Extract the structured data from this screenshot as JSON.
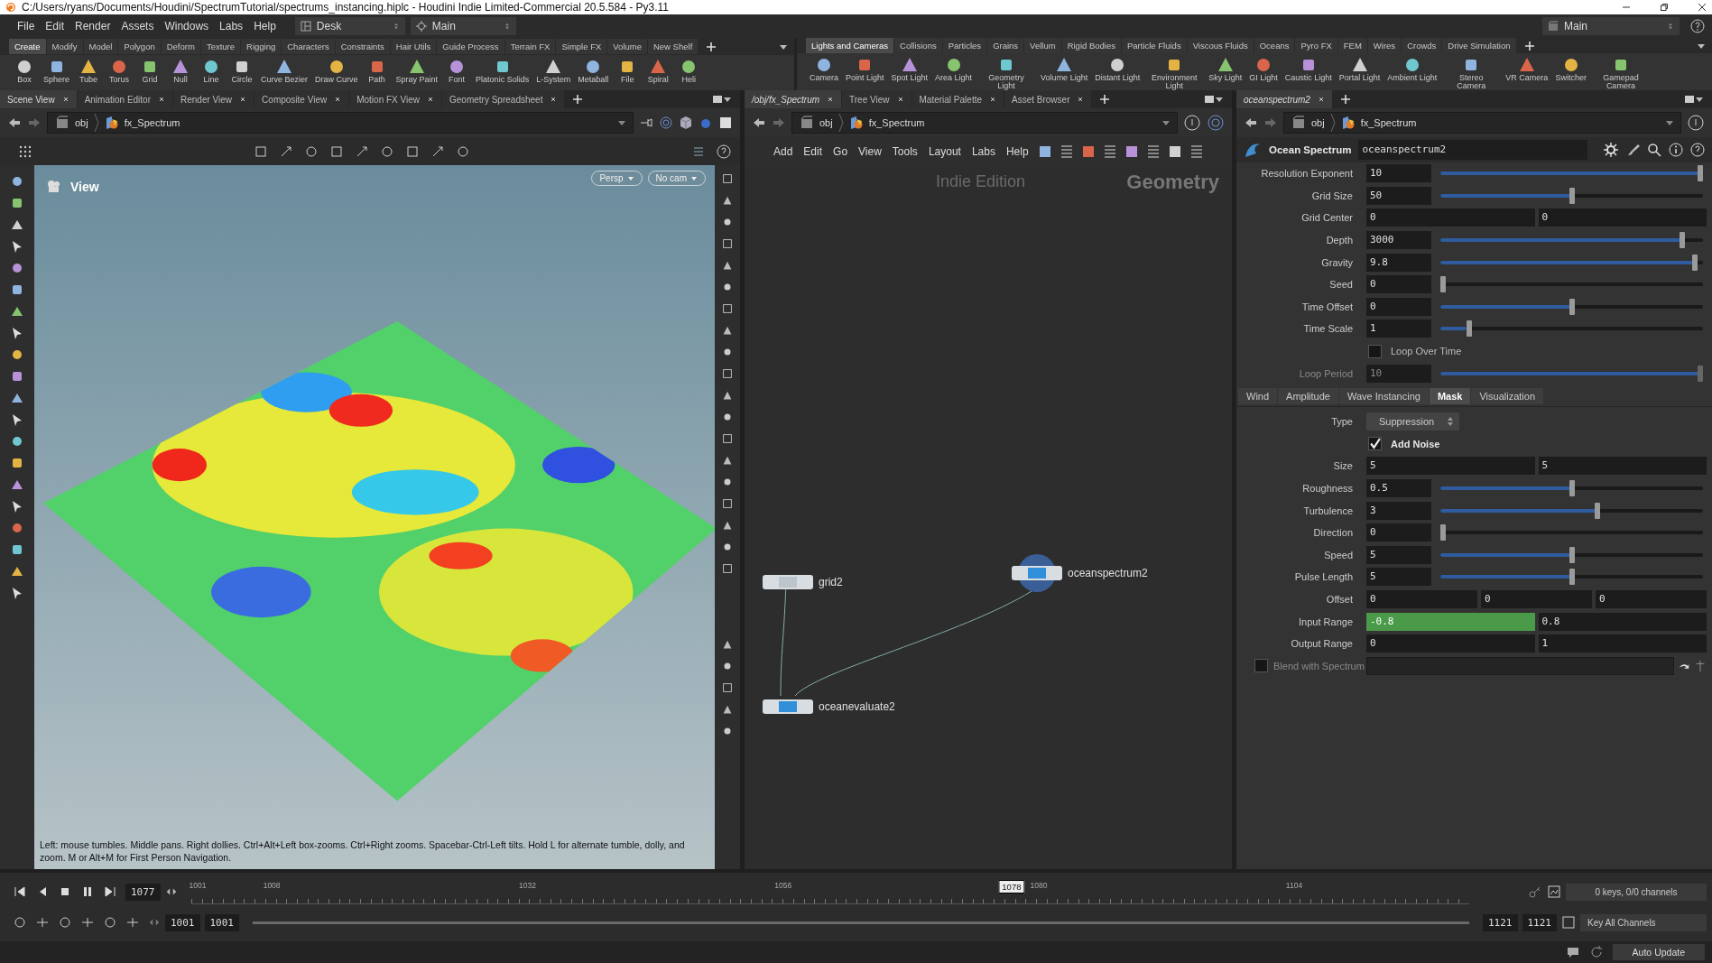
{
  "window": {
    "title": "C:/Users/ryans/Documents/Houdini/SpectrumTutorial/spectrums_instancing.hiplc - Houdini Indie Limited-Commercial 20.5.584 - Py3.11"
  },
  "menu": [
    "File",
    "Edit",
    "Render",
    "Assets",
    "Windows",
    "Labs",
    "Help"
  ],
  "desktop": {
    "label": "Desk"
  },
  "context": {
    "label": "Main"
  },
  "right_context": {
    "label": "Main"
  },
  "shelves": [
    {
      "tabs": [
        {
          "label": "Create",
          "selected": true
        },
        {
          "label": "Modify",
          "selected": false
        },
        {
          "label": "Model",
          "selected": false
        },
        {
          "label": "Polygon",
          "selected": false
        },
        {
          "label": "Deform",
          "selected": false
        },
        {
          "label": "Texture",
          "selected": false
        },
        {
          "label": "Rigging",
          "selected": false
        },
        {
          "label": "Characters",
          "selected": false
        },
        {
          "label": "Constraints",
          "selected": false
        },
        {
          "label": "Hair Utils",
          "selected": false
        },
        {
          "label": "Guide Process",
          "selected": false
        },
        {
          "label": "Terrain FX",
          "selected": false
        },
        {
          "label": "Simple FX",
          "selected": false
        },
        {
          "label": "Volume",
          "selected": false
        },
        {
          "label": "New Shelf",
          "selected": false
        }
      ],
      "tools": [
        "Box",
        "Sphere",
        "Tube",
        "Torus",
        "Grid",
        "Null",
        "Line",
        "Circle",
        "Curve Bezier",
        "Draw Curve",
        "Path",
        "Spray Paint",
        "Font",
        "Platonic Solids",
        "L-System",
        "Metaball",
        "File",
        "Spiral",
        "Heli"
      ]
    },
    {
      "tabs": [
        {
          "label": "Lights and Cameras",
          "selected": true
        },
        {
          "label": "Collisions",
          "selected": false
        },
        {
          "label": "Particles",
          "selected": false
        },
        {
          "label": "Grains",
          "selected": false
        },
        {
          "label": "Vellum",
          "selected": false
        },
        {
          "label": "Rigid Bodies",
          "selected": false
        },
        {
          "label": "Particle Fluids",
          "selected": false
        },
        {
          "label": "Viscous Fluids",
          "selected": false
        },
        {
          "label": "Oceans",
          "selected": false
        },
        {
          "label": "Pyro FX",
          "selected": false
        },
        {
          "label": "FEM",
          "selected": false
        },
        {
          "label": "Wires",
          "selected": false
        },
        {
          "label": "Crowds",
          "selected": false
        },
        {
          "label": "Drive Simulation",
          "selected": false
        }
      ],
      "tools": [
        "Camera",
        "Point Light",
        "Spot Light",
        "Area Light",
        "Geometry Light",
        "Volume Light",
        "Distant Light",
        "Environment Light",
        "Sky Light",
        "GI Light",
        "Caustic Light",
        "Portal Light",
        "Ambient Light",
        "Stereo Camera",
        "VR Camera",
        "Switcher",
        "Gamepad Camera"
      ]
    }
  ],
  "scene_pane": {
    "tabs": [
      {
        "label": "Scene View",
        "selected": true
      },
      {
        "label": "Animation Editor",
        "selected": false
      },
      {
        "label": "Render View",
        "selected": false
      },
      {
        "label": "Composite View",
        "selected": false
      },
      {
        "label": "Motion FX View",
        "selected": false
      },
      {
        "label": "Geometry Spreadsheet",
        "selected": false
      }
    ],
    "path": [
      "obj",
      "fx_Spectrum"
    ],
    "view_label": "View",
    "camera_menus": [
      "Persp",
      "No cam"
    ],
    "hint": "Left: mouse tumbles. Middle pans. Right dollies. Ctrl+Alt+Left box-zooms. Ctrl+Right zooms. Spacebar-Ctrl-Left tilts. Hold L for alternate tumble, dolly, and zoom. M or Alt+M for First Person Navigation."
  },
  "network_pane": {
    "tabs": [
      {
        "label": "/obj/fx_Spectrum",
        "selected": true
      },
      {
        "label": "Tree View",
        "selected": false
      },
      {
        "label": "Material Palette",
        "selected": false
      },
      {
        "label": "Asset Browser",
        "selected": false
      }
    ],
    "path": [
      "obj",
      "fx_Spectrum"
    ],
    "menu": [
      "Add",
      "Edit",
      "Go",
      "View",
      "Tools",
      "Layout",
      "Labs",
      "Help"
    ],
    "edition": "Indie Edition",
    "context": "Geometry",
    "nodes": [
      {
        "name": "grid2",
        "selected": false
      },
      {
        "name": "oceanspectrum2",
        "selected": true
      },
      {
        "name": "oceanevaluate2",
        "selected": false
      }
    ]
  },
  "param_pane": {
    "tabs": [
      {
        "label": "oceanspectrum2",
        "selected": true
      }
    ],
    "path": [
      "obj",
      "fx_Spectrum"
    ],
    "node_type": "Ocean Spectrum",
    "node_name": "oceanspectrum2"
  },
  "parameters": [
    {
      "kind": "slider",
      "label": "Resolution Exponent",
      "value": "10",
      "level": 1.0,
      "disabled": false
    },
    {
      "kind": "slider",
      "label": "Grid Size",
      "value": "50",
      "level": 0.5,
      "disabled": false
    },
    {
      "kind": "vector",
      "label": "Grid Center",
      "fields": [
        {
          "value": "0",
          "keyed": false
        },
        {
          "value": "0",
          "keyed": false
        }
      ],
      "disabled": false
    },
    {
      "kind": "slider",
      "label": "Depth",
      "value": "3000",
      "level": 0.93,
      "disabled": false
    },
    {
      "kind": "slider",
      "label": "Gravity",
      "value": "9.8",
      "level": 0.98,
      "disabled": false
    },
    {
      "kind": "slider",
      "label": "Seed",
      "value": "0",
      "level": 0.0,
      "disabled": false
    },
    {
      "kind": "slider",
      "label": "Time Offset",
      "value": "0",
      "level": 0.5,
      "disabled": false
    },
    {
      "kind": "slider",
      "label": "Time Scale",
      "value": "1",
      "level": 0.1,
      "disabled": false
    },
    {
      "kind": "checkbox",
      "label": "Loop Over Time",
      "checked": false,
      "disabled": false
    },
    {
      "kind": "slider",
      "label": "Loop Period",
      "value": "10",
      "level": 1.0,
      "disabled": true
    }
  ],
  "folder_tabs": [
    {
      "label": "Wind",
      "selected": false
    },
    {
      "label": "Amplitude",
      "selected": false
    },
    {
      "label": "Wave Instancing",
      "selected": false
    },
    {
      "label": "Mask",
      "selected": true
    },
    {
      "label": "Visualization",
      "selected": false
    }
  ],
  "mask_parameters": [
    {
      "kind": "menu",
      "label": "Type",
      "value": "Suppression",
      "disabled": false
    },
    {
      "kind": "checkbox",
      "label": "Add Noise",
      "checked": true,
      "disabled": false
    },
    {
      "kind": "vector",
      "label": "Size",
      "fields": [
        {
          "value": "5",
          "keyed": false
        },
        {
          "value": "5",
          "keyed": false
        }
      ],
      "disabled": false
    },
    {
      "kind": "slider",
      "label": "Roughness",
      "value": "0.5",
      "level": 0.5,
      "disabled": false
    },
    {
      "kind": "slider",
      "label": "Turbulence",
      "value": "3",
      "level": 0.6,
      "disabled": false
    },
    {
      "kind": "slider",
      "label": "Direction",
      "value": "0",
      "level": 0.0,
      "disabled": false
    },
    {
      "kind": "slider",
      "label": "Speed",
      "value": "5",
      "level": 0.5,
      "disabled": false
    },
    {
      "kind": "slider",
      "label": "Pulse Length",
      "value": "5",
      "level": 0.5,
      "disabled": false
    },
    {
      "kind": "vector",
      "label": "Offset",
      "fields": [
        {
          "value": "0",
          "keyed": false
        },
        {
          "value": "0",
          "keyed": false
        },
        {
          "value": "0",
          "keyed": false
        }
      ],
      "disabled": false
    },
    {
      "kind": "vector",
      "label": "Input Range",
      "fields": [
        {
          "value": "-0.8",
          "keyed": true
        },
        {
          "value": "0.8",
          "keyed": false
        }
      ],
      "disabled": false
    },
    {
      "kind": "vector",
      "label": "Output Range",
      "fields": [
        {
          "value": "0",
          "keyed": false
        },
        {
          "value": "1",
          "keyed": false
        }
      ],
      "disabled": false
    },
    {
      "kind": "toggle-field",
      "label": "Blend with Spectrum",
      "checked": false,
      "disabled": true
    }
  ],
  "timeline": {
    "frame": "1077",
    "ticks": [
      "1001",
      "1008",
      "1032",
      "1056",
      "1080",
      "1104"
    ],
    "current": {
      "label": "1078",
      "level": 0.642
    },
    "start": [
      "1001",
      "1001"
    ],
    "end": [
      "1121",
      "1121"
    ],
    "keys": "0 keys, 0/0 channels",
    "key_menu": "Key All Channels"
  },
  "status": {
    "update_mode": "Auto Update"
  }
}
